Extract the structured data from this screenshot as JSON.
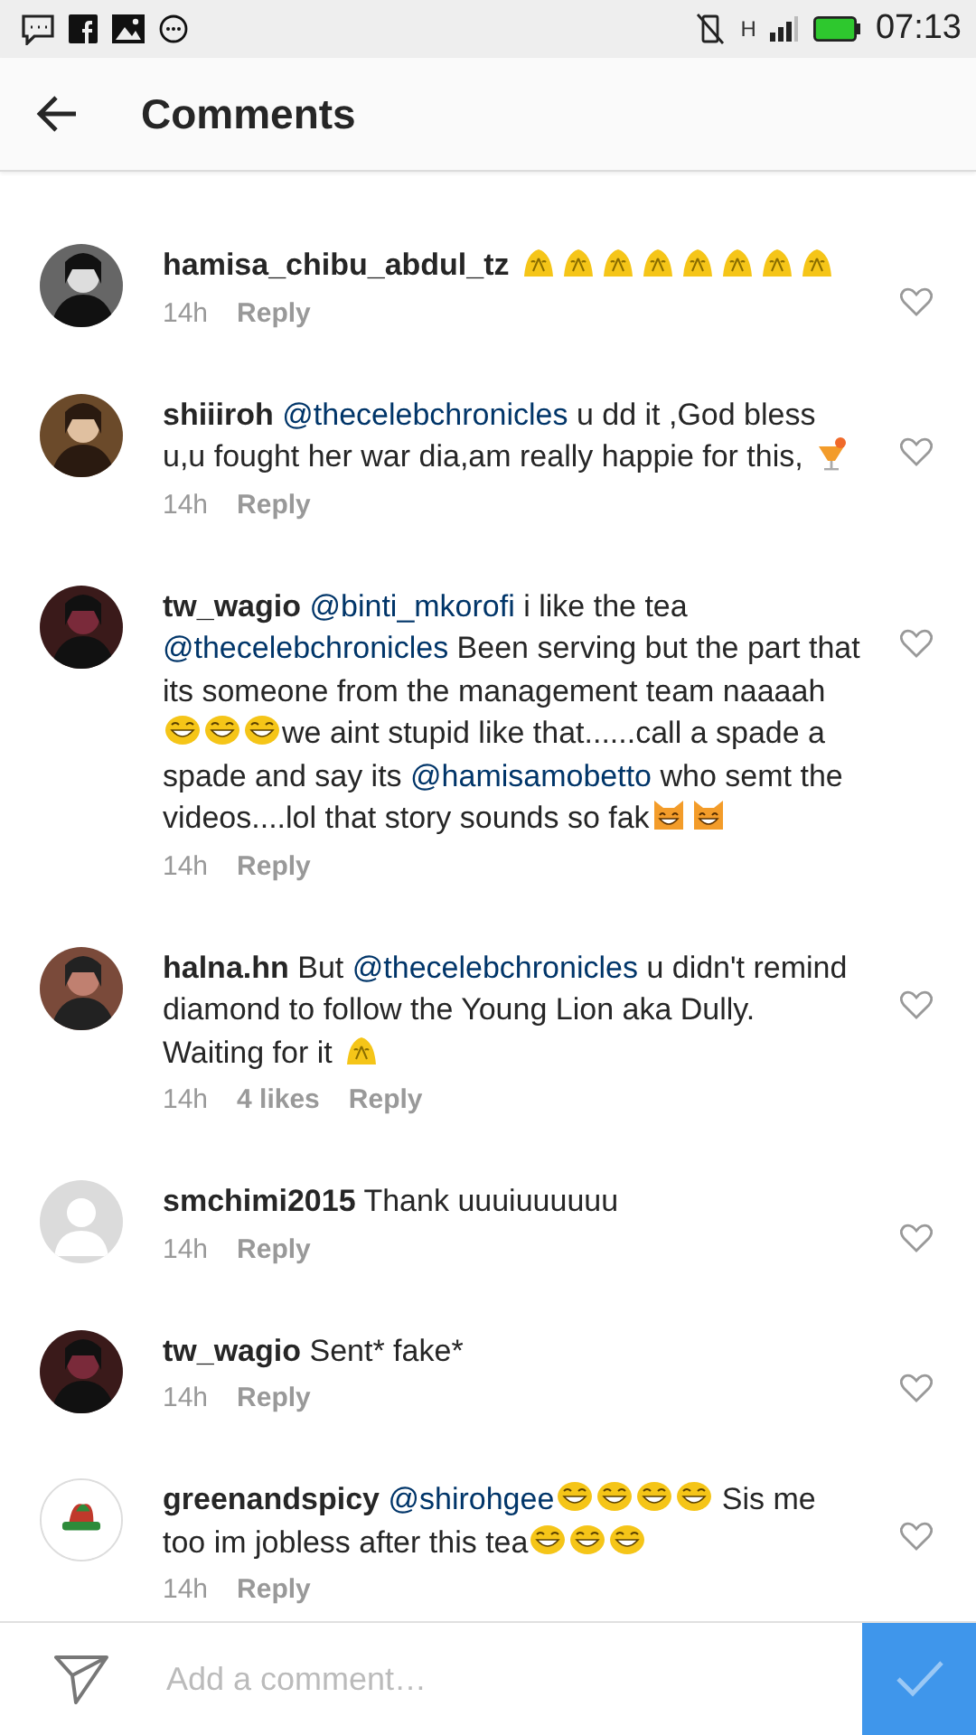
{
  "status_bar": {
    "network": "H",
    "time": "07:13"
  },
  "header": {
    "title": "Comments"
  },
  "comments": [
    {
      "user": "hamisa_chibu_abdul_tz",
      "avatar": {
        "kind": "picture"
      },
      "segments": [
        {
          "kind": "pray"
        },
        {
          "kind": "pray"
        },
        {
          "kind": "pray"
        },
        {
          "kind": "pray"
        },
        {
          "kind": "pray"
        },
        {
          "kind": "pray"
        },
        {
          "kind": "pray"
        },
        {
          "kind": "pray"
        }
      ],
      "time": "14h",
      "reply": "Reply",
      "liked": false
    },
    {
      "user": "shiiiroh",
      "avatar": {
        "kind": "picture"
      },
      "segments": [
        {
          "kind": "mention",
          "text": "@thecelebchronicles"
        },
        {
          "kind": "text",
          "text": " u dd it ,God bless u,u fought her war dia,am really happie for this, "
        },
        {
          "kind": "drink"
        }
      ],
      "time": "14h",
      "reply": "Reply",
      "liked": false
    },
    {
      "user": "tw_wagio",
      "avatar": {
        "kind": "picture"
      },
      "segments": [
        {
          "kind": "mention",
          "text": "@binti_mkorofi"
        },
        {
          "kind": "text",
          "text": " i like the tea "
        },
        {
          "kind": "mention",
          "text": "@thecelebchronicles"
        },
        {
          "kind": "text",
          "text": " Been serving but the part that its someone from the management team naaaah"
        },
        {
          "kind": "grin"
        },
        {
          "kind": "grin"
        },
        {
          "kind": "grin"
        },
        {
          "kind": "text",
          "text": "we aint stupid like that......call a spade a spade and say its "
        },
        {
          "kind": "mention",
          "text": "@hamisamobetto"
        },
        {
          "kind": "text",
          "text": " who semt the videos....lol that story sounds so fak"
        },
        {
          "kind": "cat"
        },
        {
          "kind": "cat"
        }
      ],
      "time": "14h",
      "reply": "Reply",
      "liked": false
    },
    {
      "user": "halna.hn",
      "avatar": {
        "kind": "picture"
      },
      "segments": [
        {
          "kind": "text",
          "text": "But "
        },
        {
          "kind": "mention",
          "text": "@thecelebchronicles"
        },
        {
          "kind": "text",
          "text": " u didn't remind diamond to follow the Young Lion aka Dully. Waiting for it "
        },
        {
          "kind": "pray"
        }
      ],
      "time": "14h",
      "likes": "4 likes",
      "reply": "Reply",
      "liked": false
    },
    {
      "user": "smchimi2015",
      "avatar": {
        "kind": "default"
      },
      "segments": [
        {
          "kind": "text",
          "text": "Thank uuuiuuuuuu"
        }
      ],
      "time": "14h",
      "reply": "Reply",
      "liked": false
    },
    {
      "user": "tw_wagio",
      "avatar": {
        "kind": "picture"
      },
      "segments": [
        {
          "kind": "text",
          "text": "Sent* fake*"
        }
      ],
      "time": "14h",
      "reply": "Reply",
      "liked": false
    },
    {
      "user": "greenandspicy",
      "avatar": {
        "kind": "logo"
      },
      "segments": [
        {
          "kind": "mention",
          "text": "@shirohgee"
        },
        {
          "kind": "grin"
        },
        {
          "kind": "grin"
        },
        {
          "kind": "grin"
        },
        {
          "kind": "grin"
        },
        {
          "kind": "text",
          "text": " Sis me too im jobless after this tea"
        },
        {
          "kind": "grin"
        },
        {
          "kind": "grin"
        },
        {
          "kind": "grin"
        }
      ],
      "time": "14h",
      "reply": "Reply",
      "liked": false
    }
  ],
  "composer": {
    "placeholder": "Add a comment…"
  }
}
